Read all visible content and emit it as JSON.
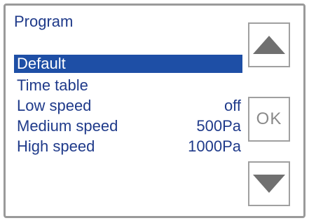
{
  "screen": {
    "title": "Program"
  },
  "menu": {
    "items": [
      {
        "label": "Default",
        "value": "",
        "selected": true
      },
      {
        "label": "Time  table",
        "value": "",
        "selected": false
      },
      {
        "label": "Low  speed",
        "value": "off",
        "selected": false
      },
      {
        "label": "Medium  speed",
        "value": "500Pa",
        "selected": false
      },
      {
        "label": "High  speed",
        "value": "1000Pa",
        "selected": false
      }
    ]
  },
  "buttons": {
    "up_icon": "arrow-up-icon",
    "ok_label": "OK",
    "down_icon": "arrow-down-icon"
  },
  "colors": {
    "text": "#1f3a8a",
    "selection": "#1e4fa6",
    "button_border": "#a0a0a0",
    "arrow": "#707070"
  }
}
